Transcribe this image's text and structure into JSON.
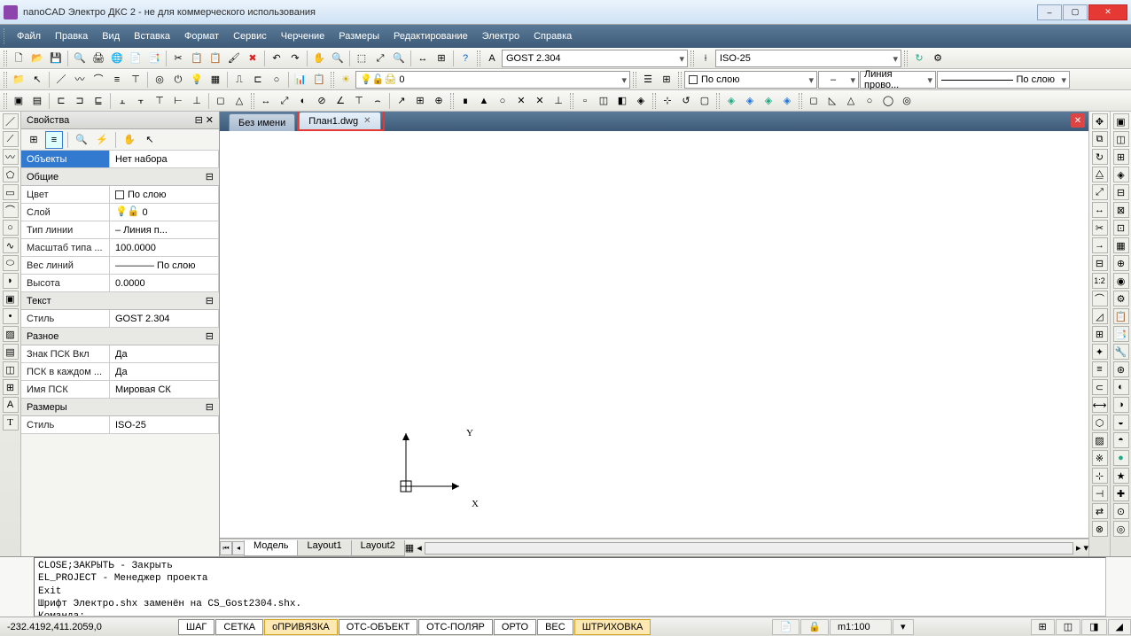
{
  "window": {
    "title": "nanoCAD Электро ДКС 2 - не для коммерческого использования"
  },
  "menus": [
    "Файл",
    "Правка",
    "Вид",
    "Вставка",
    "Формат",
    "Сервис",
    "Черчение",
    "Размеры",
    "Редактирование",
    "Электро",
    "Справка"
  ],
  "combos": {
    "textstyle": "GOST 2.304",
    "dimstyle": "ISO-25",
    "layer": "0",
    "color": "По слою",
    "linetype_short": "–",
    "linetype": "Линия прово...",
    "lineweight": "По слою"
  },
  "tabs": {
    "doc1": "Без имени",
    "doc2": "План1.dwg"
  },
  "layout_tabs": [
    "Модель",
    "Layout1",
    "Layout2"
  ],
  "props": {
    "panel_title": "Свойства",
    "objects_label": "Объекты",
    "objects_value": "Нет набора",
    "group_general": "Общие",
    "color_label": "Цвет",
    "color_value": "По слою",
    "layer_label": "Слой",
    "layer_value": "0",
    "ltype_label": "Тип линии",
    "ltype_value": "–       Линия п...",
    "ltscale_label": "Масштаб типа ...",
    "ltscale_value": "100.0000",
    "lweight_label": "Вес линий",
    "lweight_value": "———— По слою",
    "height_label": "Высота",
    "height_value": "0.0000",
    "group_text": "Текст",
    "tstyle_label": "Стиль",
    "tstyle_value": "GOST 2.304",
    "group_misc": "Разное",
    "ucs_on_label": "Знак ПСК Вкл",
    "ucs_on_value": "Да",
    "ucs_each_label": "ПСК в каждом ...",
    "ucs_each_value": "Да",
    "ucs_name_label": "Имя ПСК",
    "ucs_name_value": "Мировая СК",
    "group_dims": "Размеры",
    "dstyle_label": "Стиль",
    "dstyle_value": "ISO-25"
  },
  "ucs": {
    "x": "X",
    "y": "Y"
  },
  "console_text": "CLOSE;ЗАКРЫТЬ - Закрыть\nEL_PROJECT - Менеджер проекта\nExit\nШрифт Электро.shx заменён на CS_Gost2304.shx.\nКоманда:",
  "status": {
    "coords": "-232.4192,411.2059,0",
    "snap": "ШАГ",
    "grid": "СЕТКА",
    "osnap": "оПРИВЯЗКА",
    "otrack": "ОТС-ОБЪЕКТ",
    "ptrack": "ОТС-ПОЛЯР",
    "ortho": "ОРТО",
    "lwt": "ВЕС",
    "hatch": "ШТРИХОВКА",
    "scale": "m1:100",
    "ratio": "1:2"
  }
}
